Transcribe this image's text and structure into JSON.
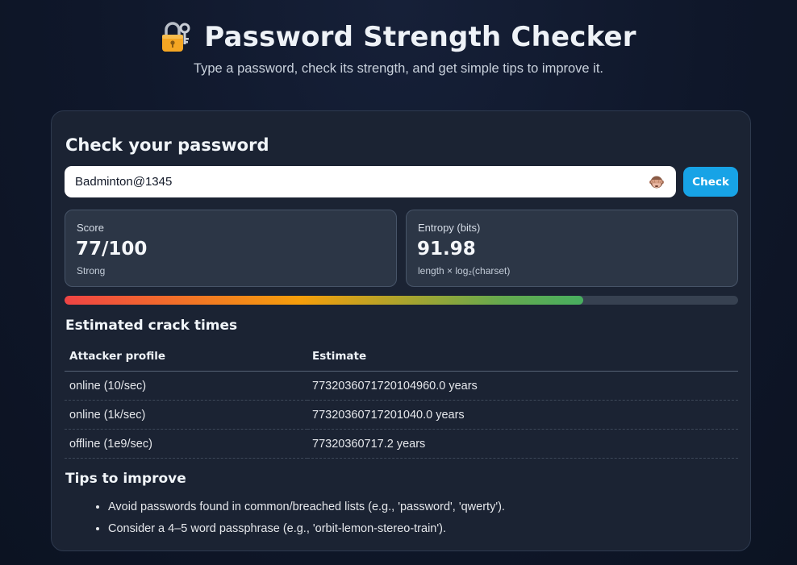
{
  "header": {
    "title": "Password Strength Checker",
    "subtitle": "Type a password, check its strength, and get simple tips to improve it.",
    "title_icon": "lock-with-key-icon"
  },
  "checker": {
    "heading": "Check your password",
    "password_value": "Badminton@1345",
    "toggle_icon": "see-no-evil-monkey-icon",
    "check_label": "Check"
  },
  "stats": {
    "score": {
      "label": "Score",
      "value": "77/100",
      "rating": "Strong"
    },
    "entropy": {
      "label": "Entropy (bits)",
      "value": "91.98",
      "formula": "length × log₂(charset)"
    }
  },
  "meter": {
    "fill_fraction": 0.77,
    "colors": [
      "#ef4444",
      "#f59e0b",
      "#10b981"
    ]
  },
  "crack_times": {
    "heading": "Estimated crack times",
    "columns": [
      "Attacker profile",
      "Estimate"
    ],
    "rows": [
      {
        "profile": "online (10/sec)",
        "estimate": "7732036071720104960.0 years"
      },
      {
        "profile": "online (1k/sec)",
        "estimate": "77320360717201040.0 years"
      },
      {
        "profile": "offline (1e9/sec)",
        "estimate": "77320360717.2 years"
      }
    ]
  },
  "tips": {
    "heading": "Tips to improve",
    "items": [
      "Avoid passwords found in common/breached lists (e.g., 'password', 'qwerty').",
      "Consider a 4–5 word passphrase (e.g., 'orbit-lemon-stereo-train')."
    ]
  },
  "colors": {
    "accent": "#17a3e6",
    "background": "#0f172a",
    "card": "#1b2333"
  }
}
